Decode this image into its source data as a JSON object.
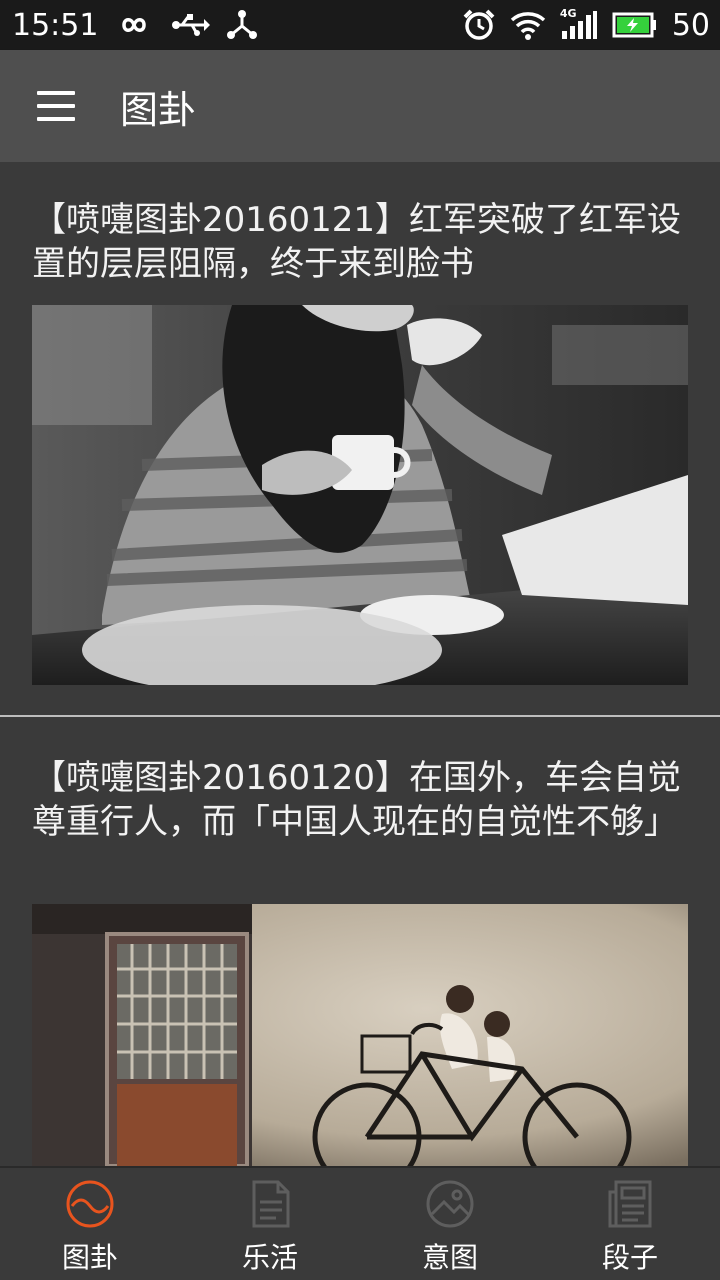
{
  "status_bar": {
    "time": "15:51",
    "icons_left": [
      "infinity-icon",
      "usb-icon",
      "share-icon"
    ],
    "icons_right": [
      "alarm-icon",
      "wifi-icon",
      "4g-signal-icon",
      "battery-icon"
    ],
    "network_label": "4G",
    "battery_level": "50"
  },
  "app_bar": {
    "menu_icon": "hamburger-menu-icon",
    "title": "图卦"
  },
  "articles": [
    {
      "title": "【喷嚏图卦20160121】红军突破了红军设置的层层阻隔，终于来到脸书",
      "image": "woman-drinking-espresso-photo"
    },
    {
      "title": "【喷嚏图卦20160120】在国外，车会自觉尊重行人，而「中国人现在的自觉性不够」",
      "image": "children-on-bicycle-mural-photo"
    }
  ],
  "tabs": [
    {
      "label": "图卦",
      "icon": "wave-circle-icon",
      "active": true
    },
    {
      "label": "乐活",
      "icon": "document-icon",
      "active": false
    },
    {
      "label": "意图",
      "icon": "picture-circle-icon",
      "active": false
    },
    {
      "label": "段子",
      "icon": "newspaper-icon",
      "active": false
    }
  ],
  "colors": {
    "status_bar_bg": "#1a1a1a",
    "app_bar_bg": "#4f4f4f",
    "content_bg": "#3a3a3a",
    "active_tab_accent": "#e8541e",
    "inactive_tab_icon": "#5e5e5e",
    "battery_fill": "#35d13c"
  }
}
